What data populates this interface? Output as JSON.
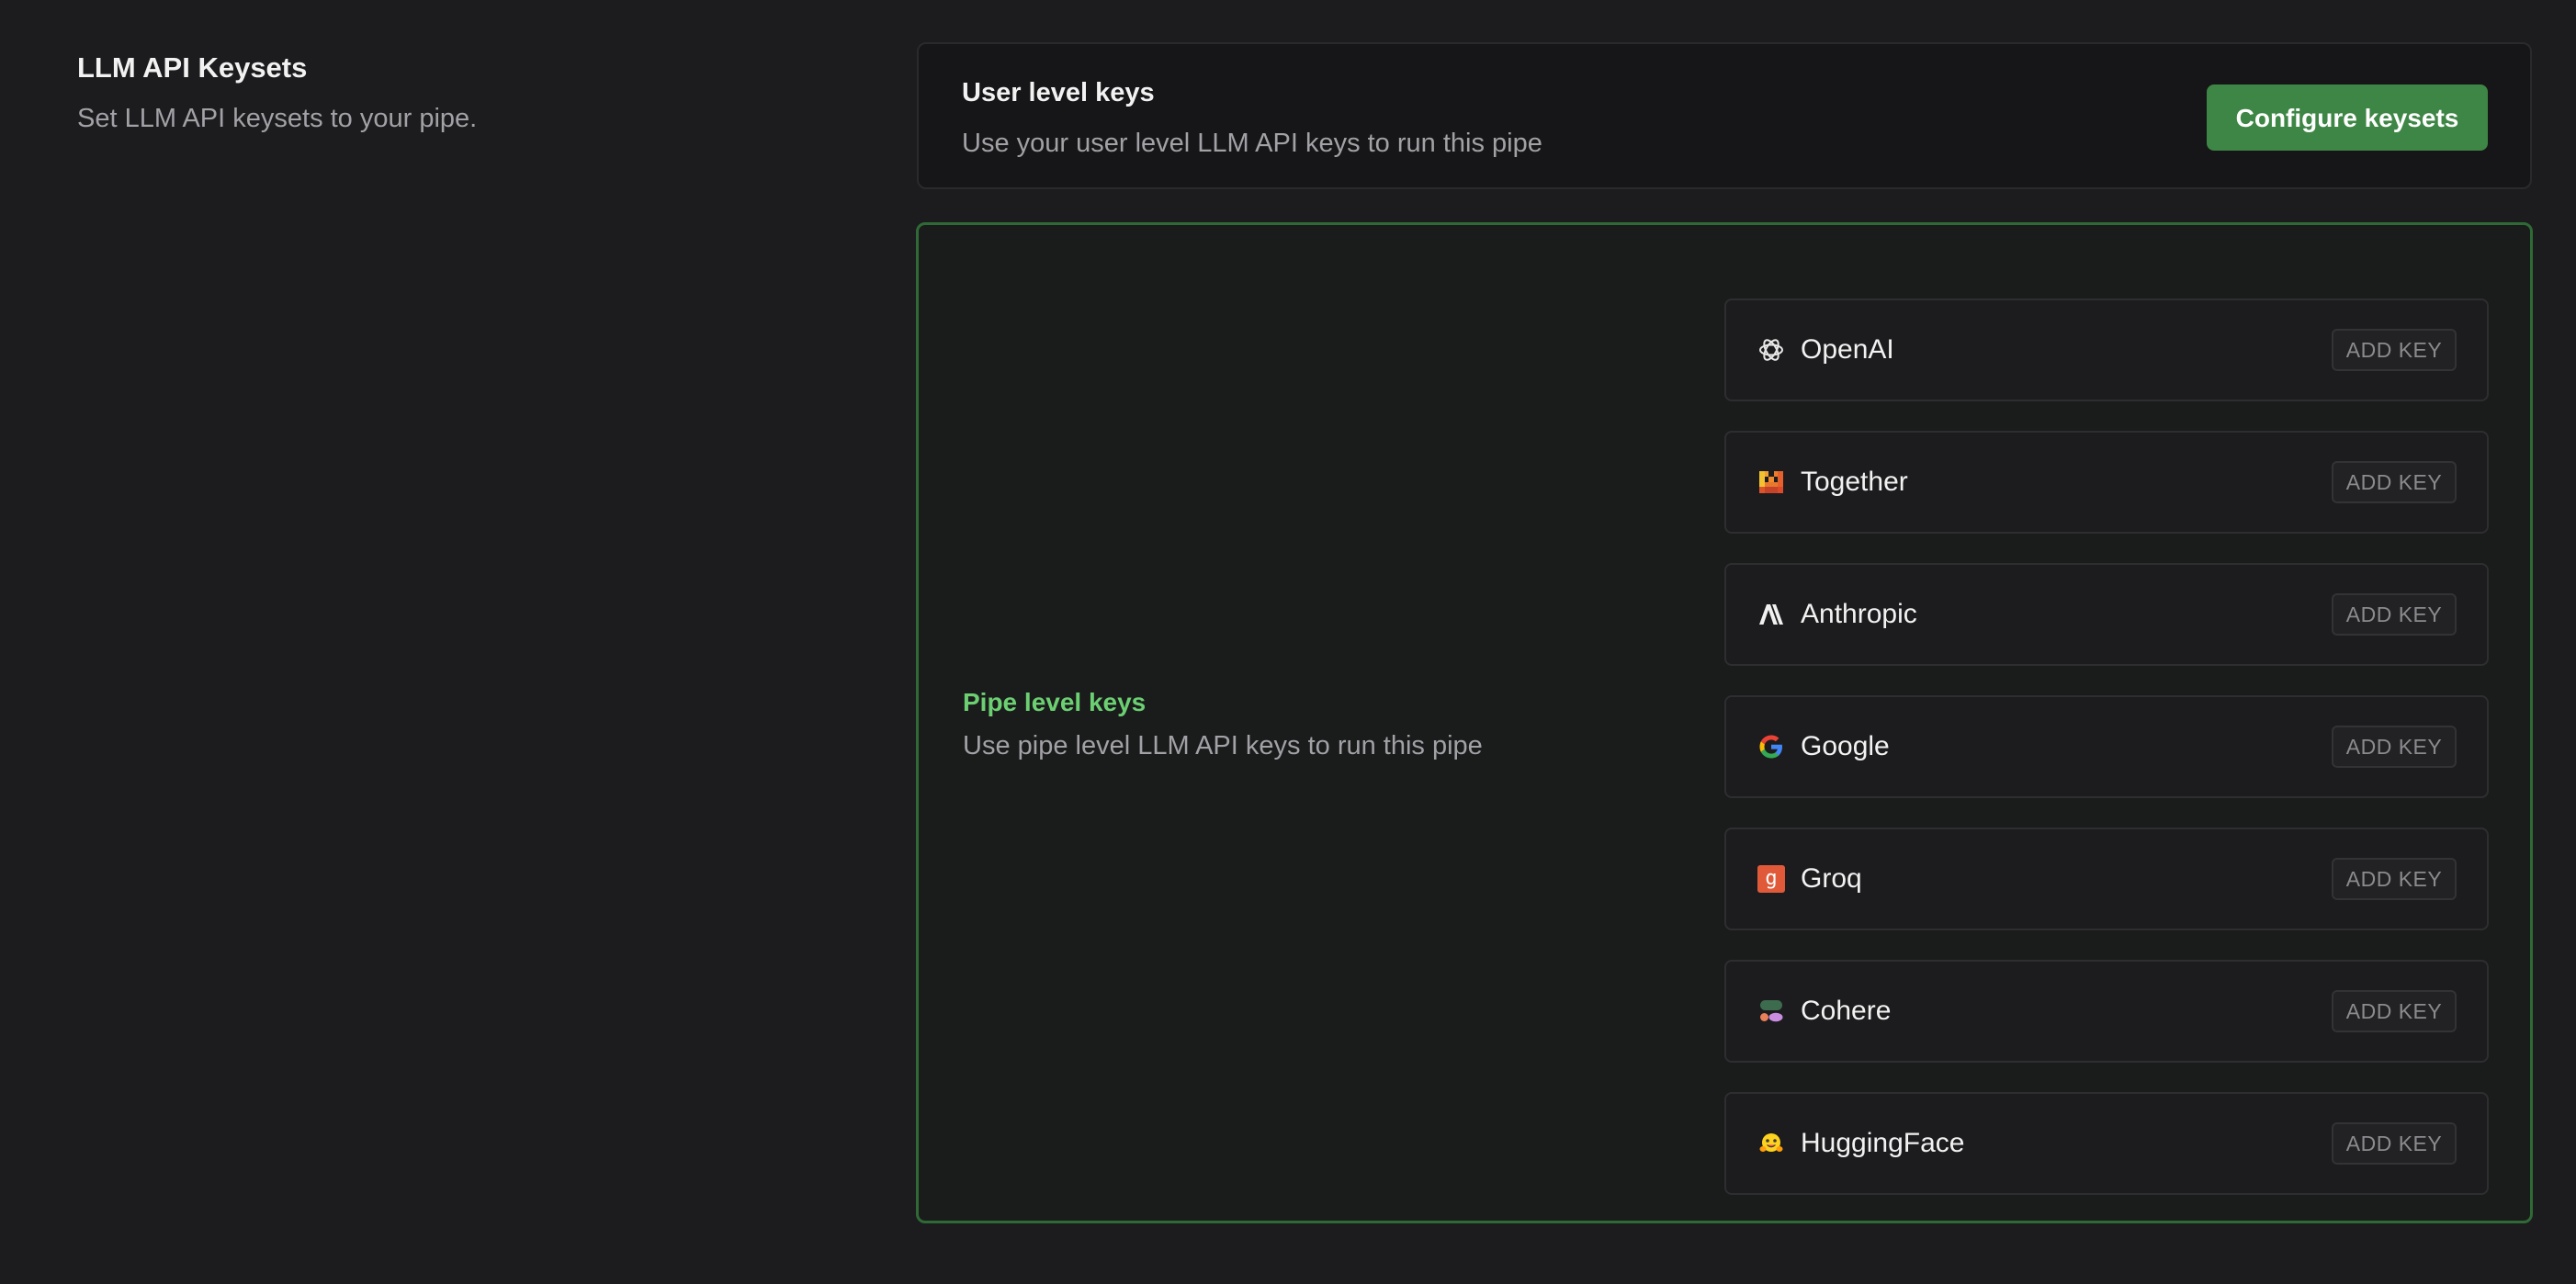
{
  "intro": {
    "title": "LLM API Keysets",
    "description": "Set LLM API keysets to your pipe."
  },
  "user_keys": {
    "title": "User level keys",
    "description": "Use your user level LLM API keys to run this pipe",
    "configure_label": "Configure keysets"
  },
  "pipe_keys": {
    "title": "Pipe level keys",
    "description": "Use pipe level LLM API keys to run this pipe"
  },
  "providers": [
    {
      "name": "OpenAI",
      "icon": "openai-icon",
      "action": "ADD KEY"
    },
    {
      "name": "Together",
      "icon": "together-icon",
      "action": "ADD KEY"
    },
    {
      "name": "Anthropic",
      "icon": "anthropic-icon",
      "action": "ADD KEY"
    },
    {
      "name": "Google",
      "icon": "google-icon",
      "action": "ADD KEY"
    },
    {
      "name": "Groq",
      "icon": "groq-icon",
      "action": "ADD KEY",
      "icon_glyph": "g"
    },
    {
      "name": "Cohere",
      "icon": "cohere-icon",
      "action": "ADD KEY"
    },
    {
      "name": "HuggingFace",
      "icon": "huggingface-icon",
      "action": "ADD KEY"
    }
  ],
  "colors": {
    "background": "#1c1c1e",
    "accent_green": "#3e8645",
    "pipe_title_green": "#6ccf72",
    "pipe_border_green": "#2f6a36"
  }
}
